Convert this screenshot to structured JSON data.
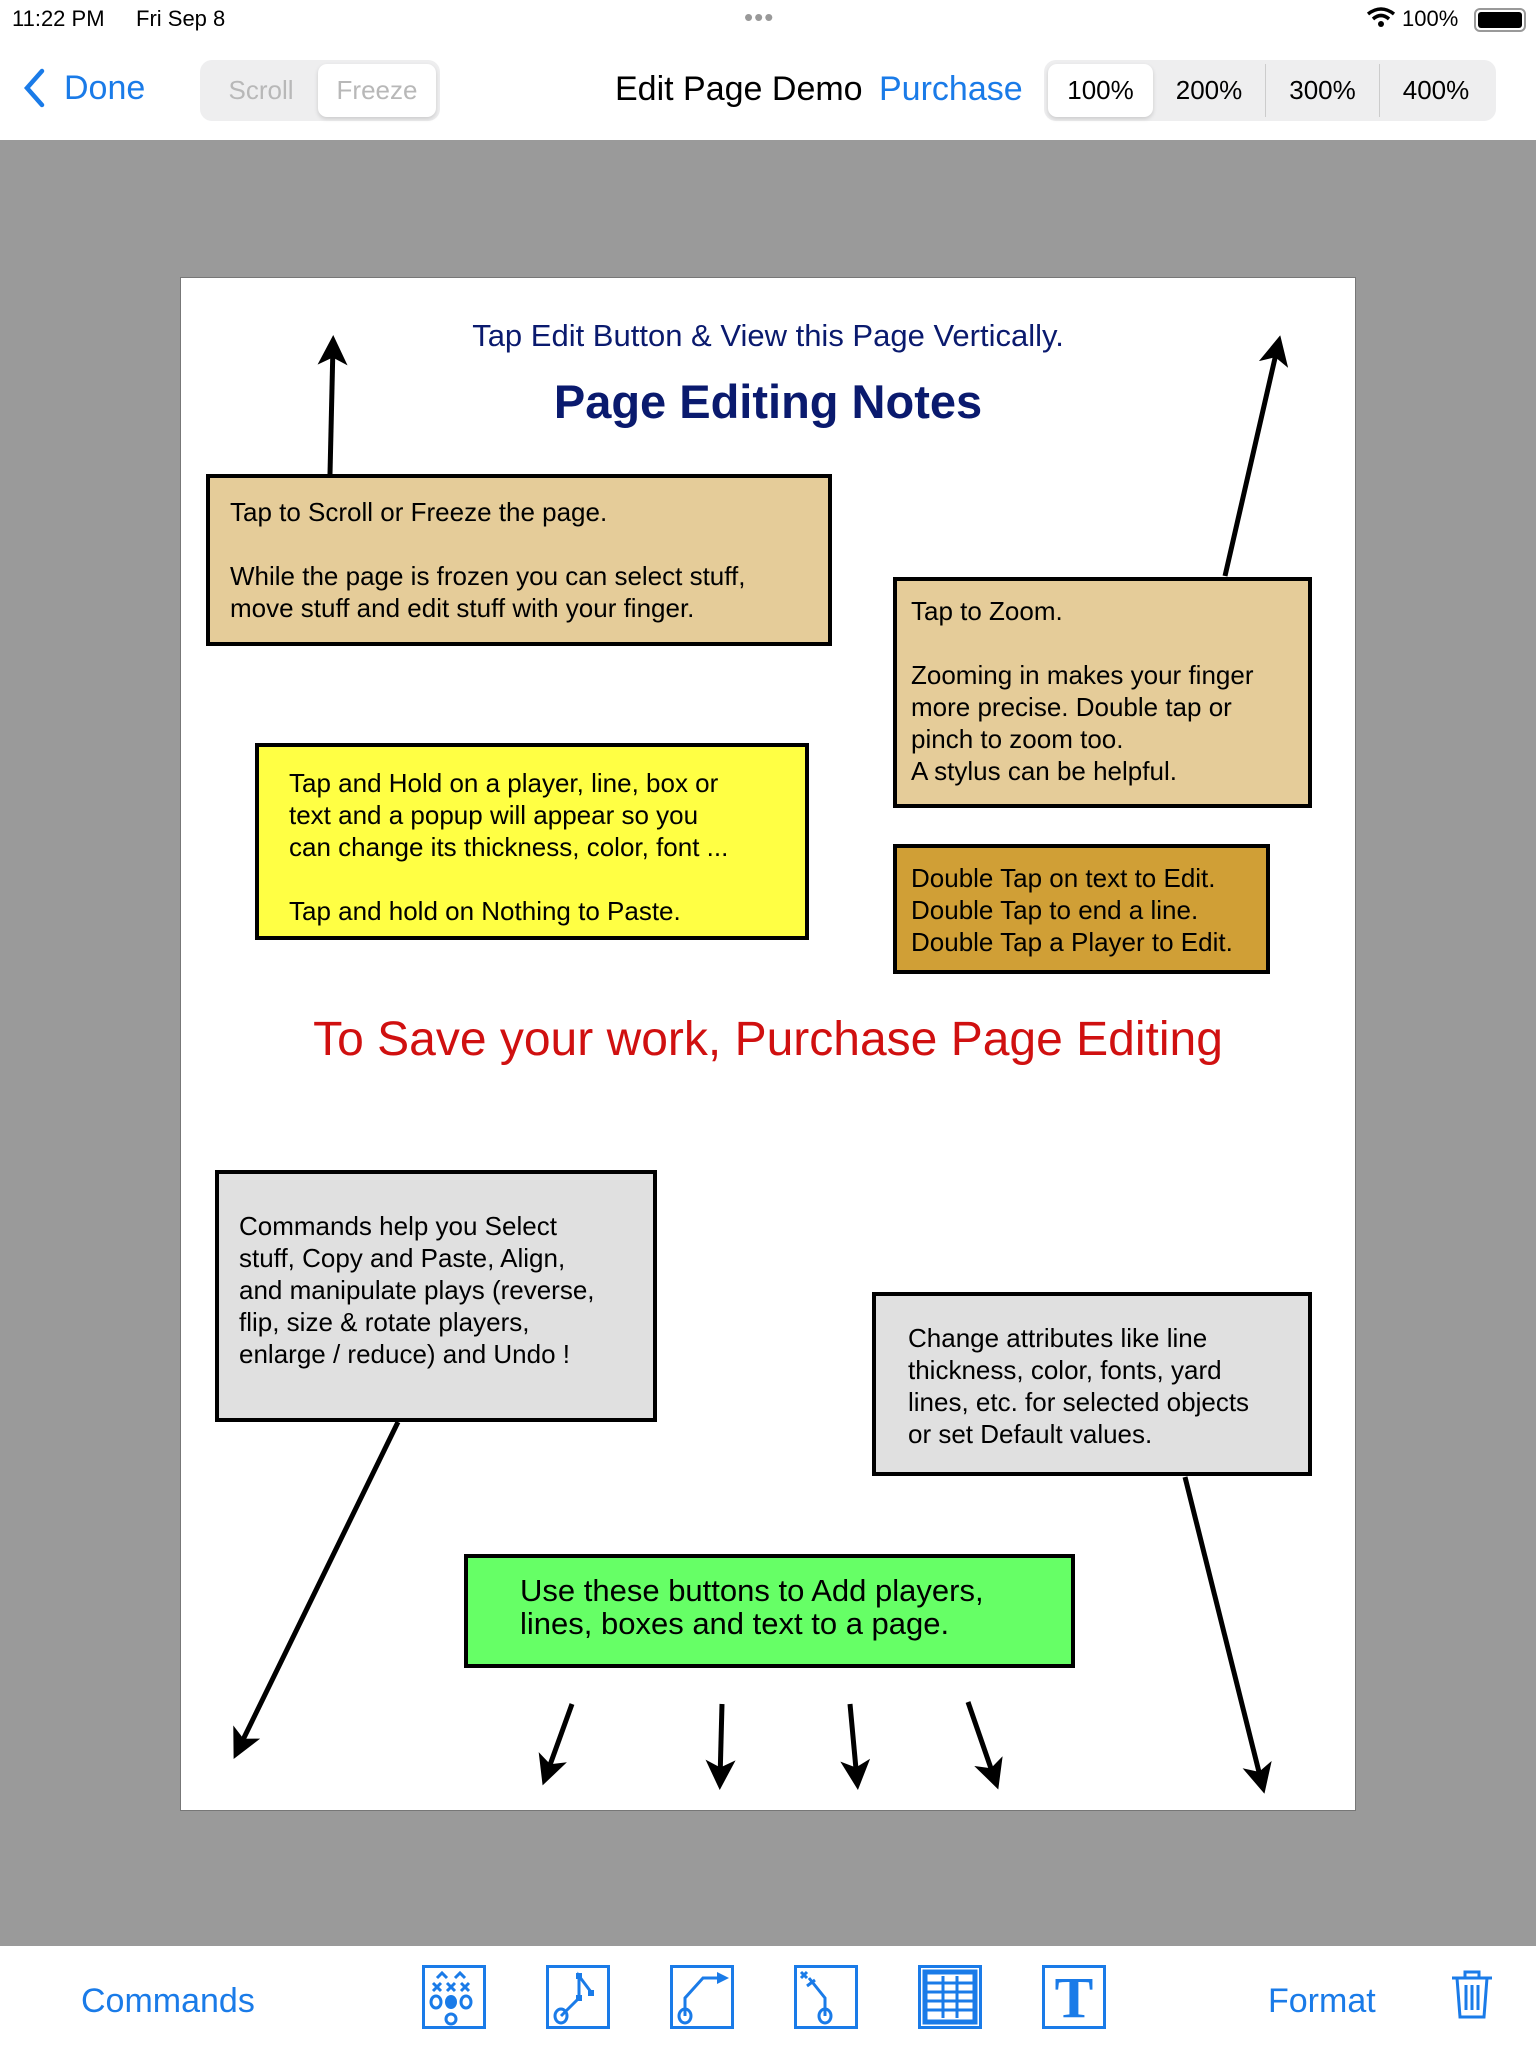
{
  "status": {
    "time": "11:22 PM",
    "date": "Fri Sep 8",
    "battery": "100%",
    "dots": "•••"
  },
  "nav": {
    "done": "Done",
    "scroll": "Scroll",
    "freeze": "Freeze",
    "title": "Edit Page Demo",
    "purchase": "Purchase",
    "zoom": [
      "100%",
      "200%",
      "300%",
      "400%"
    ],
    "zoom_selected": "100%"
  },
  "page": {
    "subtitle": "Tap Edit Button & View this Page Vertically.",
    "title": "Page Editing Notes",
    "save_notice": "To Save your work, Purchase Page Editing",
    "boxes": {
      "scroll": "Tap to Scroll or Freeze the page.\n\nWhile the page is frozen you can select stuff,\nmove stuff and edit stuff with your finger.",
      "zoom": "Tap to Zoom.\n\nZooming in makes your finger\nmore precise.  Double tap or\npinch to zoom too.\nA stylus can be helpful.",
      "hold": "Tap and Hold on a player, line, box or\ntext and a popup will appear so you\ncan change its thickness, color, font ...\n\nTap and hold on Nothing to Paste.",
      "double": "Double Tap on text to Edit.\nDouble Tap to end a line.\nDouble Tap a Player to Edit.",
      "commands": "Commands help you Select\nstuff, Copy and Paste, Align,\nand manipulate plays (reverse,\nflip, size & rotate players,\nenlarge / reduce) and Undo !",
      "attributes": "Change attributes like line\nthickness, color, fonts, yard\nlines, etc. for selected objects\n or set Default values.",
      "add": "Use these buttons to Add players,\nlines, boxes and text to a page."
    }
  },
  "toolbar": {
    "commands": "Commands",
    "format": "Format",
    "tools": [
      "add-players",
      "add-line",
      "add-arrow-line",
      "add-block-line",
      "add-box",
      "add-text"
    ],
    "text_glyph": "T"
  },
  "colors": {
    "accent": "#1a7be8",
    "navy": "#0a1a6e",
    "red": "#d01010",
    "tan": "#e5cc99",
    "yellow": "#ffff44",
    "gold": "#d09f36",
    "gray": "#e0e0e0",
    "green": "#66ff66"
  }
}
